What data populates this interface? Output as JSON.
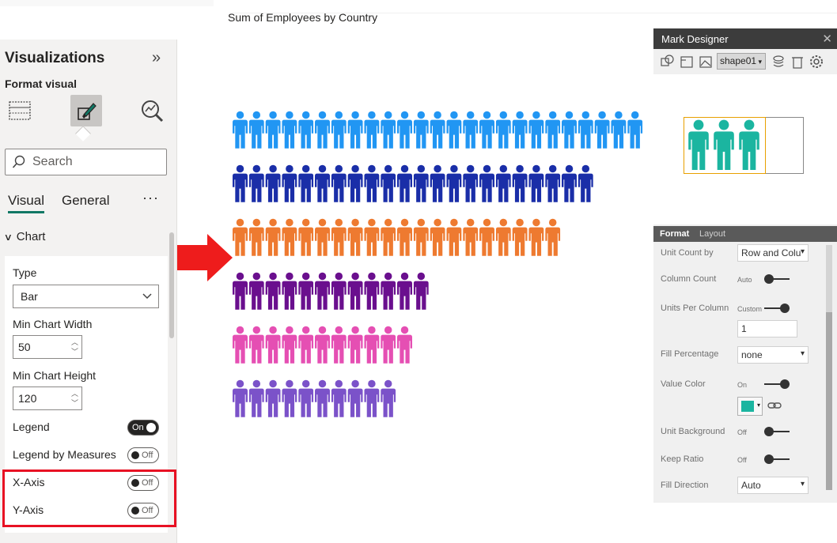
{
  "chart": {
    "title": "Sum of Employees by Country"
  },
  "chart_data": {
    "type": "bar",
    "title": "Sum of Employees by Country",
    "unit_shape": "person-icon",
    "series": [
      {
        "units": 25,
        "color": "#2196f3"
      },
      {
        "units": 22,
        "color": "#1a2ea8"
      },
      {
        "units": 20,
        "color": "#ee7a30"
      },
      {
        "units": 12,
        "color": "#6a0f8e"
      },
      {
        "units": 11,
        "color": "#e54fb3"
      },
      {
        "units": 10,
        "color": "#7b52c9"
      }
    ]
  },
  "viz_pane": {
    "title": "Visualizations",
    "subtitle": "Format visual",
    "search_placeholder": "Search",
    "tabs": [
      "Visual",
      "General"
    ],
    "more": "···",
    "section": "Chart",
    "type_label": "Type",
    "type_value": "Bar",
    "min_width_label": "Min Chart Width",
    "min_width_value": "50",
    "min_height_label": "Min Chart Height",
    "min_height_value": "120",
    "legend_label": "Legend",
    "legend_toggle": "On",
    "legend_by_measures_label": "Legend by Measures",
    "legend_by_measures_toggle": "Off",
    "x_axis_label": "X-Axis",
    "x_axis_toggle": "Off",
    "y_axis_label": "Y-Axis",
    "y_axis_toggle": "Off"
  },
  "mark_designer": {
    "title": "Mark Designer",
    "shape": "shape01",
    "tabs": [
      "Format",
      "Layout"
    ],
    "unit_count_by_label": "Unit Count by",
    "unit_count_by_value": "Row and Colu",
    "column_count_label": "Column Count",
    "column_count_mode": "Auto",
    "units_per_column_label": "Units Per Column",
    "units_per_column_mode": "Custom",
    "units_per_column_value": "1",
    "fill_percentage_label": "Fill Percentage",
    "fill_percentage_value": "none",
    "value_color_label": "Value Color",
    "value_color_state": "On",
    "value_color": "#1bb5a0",
    "unit_background_label": "Unit Background",
    "unit_background_state": "Off",
    "keep_ratio_label": "Keep Ratio",
    "keep_ratio_state": "Off",
    "fill_direction_label": "Fill Direction",
    "fill_direction_value": "Auto"
  },
  "colors": {
    "accent_teal": "#117865",
    "highlight_red": "#e81123",
    "arrow_red": "#ee1c1c"
  }
}
